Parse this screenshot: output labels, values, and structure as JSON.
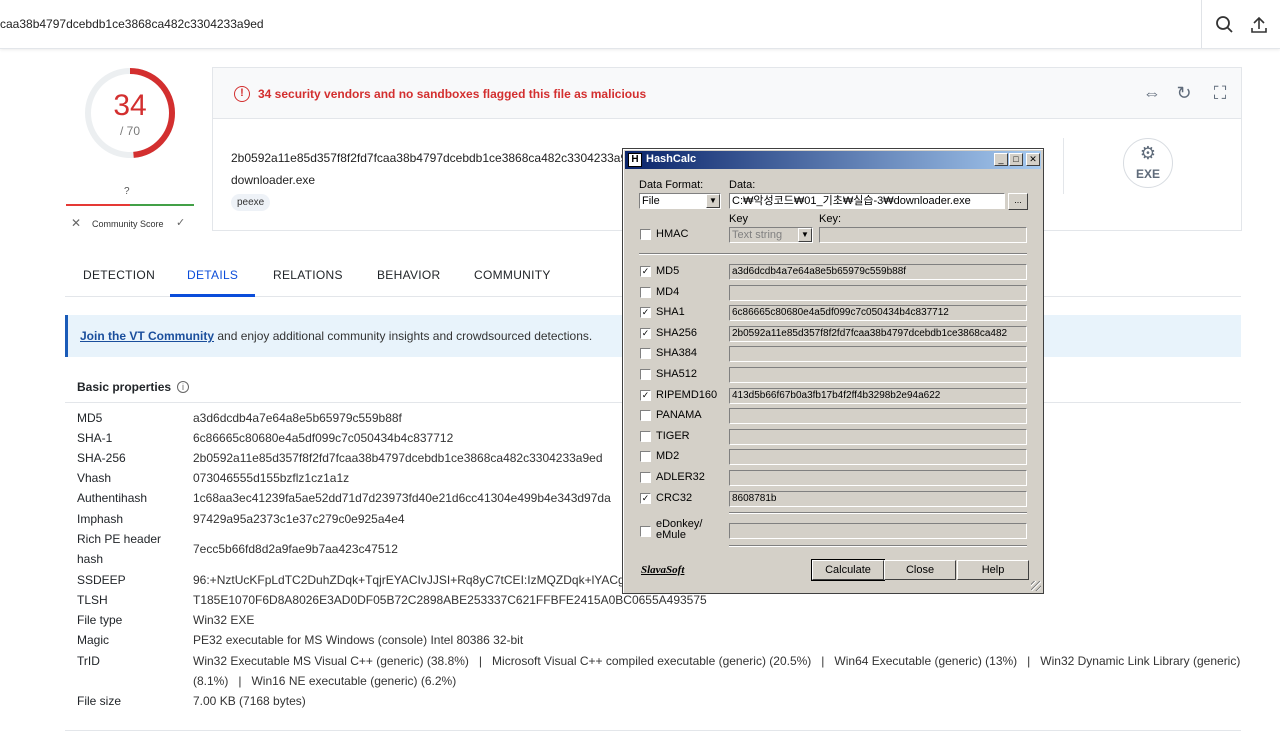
{
  "topbar": {
    "query": "caa38b4797dcebdb1ce3868ca482c3304233a9ed",
    "search_icon": "search-icon",
    "upload_icon": "upload-icon"
  },
  "score": {
    "detections": "34",
    "total": "/ 70",
    "ratio": 0.4857,
    "community_question": "?",
    "community_label": "Community Score",
    "community_x": "✕",
    "community_check": "✓"
  },
  "summary": {
    "alert": "34 security vendors and no sandboxes flagged this file as malicious",
    "hash": "2b0592a11e85d357f8f2fd7fcaa38b4797dcebdb1ce3868ca482c3304233a9",
    "filename": "downloader.exe",
    "tag": "peexe",
    "file_type_badge": "EXE",
    "colors": {
      "malicious": "#d32f2f",
      "accent": "#0b4dda"
    }
  },
  "tabs": [
    "DETECTION",
    "DETAILS",
    "RELATIONS",
    "BEHAVIOR",
    "COMMUNITY"
  ],
  "banner": {
    "link": "Join the VT Community",
    "text": " and enjoy additional community insights and crowdsourced detections."
  },
  "basic_properties": {
    "title": "Basic properties",
    "rows": [
      {
        "label": "MD5",
        "value": "a3d6dcdb4a7e64a8e5b65979c559b88f"
      },
      {
        "label": "SHA-1",
        "value": "6c86665c80680e4a5df099c7c050434b4c837712"
      },
      {
        "label": "SHA-256",
        "value": "2b0592a11e85d357f8f2fd7fcaa38b4797dcebdb1ce3868ca482c3304233a9ed"
      },
      {
        "label": "Vhash",
        "value": "073046555d155bzflz1cz1a1z"
      },
      {
        "label": "Authentihash",
        "value": "1c68aa3ec41239fa5ae52dd71d7d23973fd40e21d6cc41304e499b4e343d97da"
      },
      {
        "label": "Imphash",
        "value": "97429a95a2373c1e37c279c0e925a4e4"
      },
      {
        "label": "Rich PE header",
        "label2": "hash",
        "value": "7ecc5b66fd8d2a9fae9b7aa423c47512"
      },
      {
        "label": "SSDEEP",
        "value": "96:+NztUcKFpLdTC2DuhZDqk+TqjrEYACIvJJSI+Rq8yC7tCEI:IzMQZDqk+lYACg"
      },
      {
        "label": "TLSH",
        "value": "T185E1070F6D8A8026E3AD0DF05B72C2898ABE253337C621FFBFE2415A0BC0655A493575"
      },
      {
        "label": "File type",
        "value": "Win32 EXE"
      },
      {
        "label": "Magic",
        "value": "PE32 executable for MS Windows (console) Intel 80386 32-bit"
      },
      {
        "label": "TrID",
        "value": "Win32 Executable MS Visual C++ (generic) (38.8%)   |   Microsoft Visual C++ compiled executable (generic) (20.5%)   |   Win64 Executable (generic) (13%)   |   Win32 Dynamic Link Library (generic)",
        "value2": "(8.1%)   |   Win16 NE executable (generic) (6.2%)"
      },
      {
        "label": "File size",
        "value": "7.00 KB (7168 bytes)"
      }
    ]
  },
  "hashcalc": {
    "title": "HashCalc",
    "data_format_label": "Data Format:",
    "data_format_value": "File",
    "data_label": "Data:",
    "data_value": "C:₩악성코드₩01_기초₩실습-3₩downloader.exe",
    "browse": "...",
    "key_label": "Key",
    "key_label2": "Key:",
    "key_format": "Text string",
    "hmac_label": "HMAC",
    "algorithms": [
      {
        "name": "MD5",
        "checked": true,
        "value": "a3d6dcdb4a7e64a8e5b65979c559b88f"
      },
      {
        "name": "MD4",
        "checked": false,
        "value": ""
      },
      {
        "name": "SHA1",
        "checked": true,
        "value": "6c86665c80680e4a5df099c7c050434b4c837712"
      },
      {
        "name": "SHA256",
        "checked": true,
        "value": "2b0592a11e85d357f8f2fd7fcaa38b4797dcebdb1ce3868ca482"
      },
      {
        "name": "SHA384",
        "checked": false,
        "value": ""
      },
      {
        "name": "SHA512",
        "checked": false,
        "value": ""
      },
      {
        "name": "RIPEMD160",
        "checked": true,
        "value": "413d5b66f67b0a3fb17b4f2ff4b3298b2e94a622"
      },
      {
        "name": "PANAMA",
        "checked": false,
        "value": ""
      },
      {
        "name": "TIGER",
        "checked": false,
        "value": ""
      },
      {
        "name": "MD2",
        "checked": false,
        "value": ""
      },
      {
        "name": "ADLER32",
        "checked": false,
        "value": ""
      },
      {
        "name": "CRC32",
        "checked": true,
        "value": "8608781b"
      }
    ],
    "edonkey": {
      "name1": "eDonkey/",
      "name2": "eMule",
      "checked": false,
      "value": ""
    },
    "brand": "SlavaSoft",
    "calculate": "Calculate",
    "close": "Close",
    "help": "Help"
  }
}
